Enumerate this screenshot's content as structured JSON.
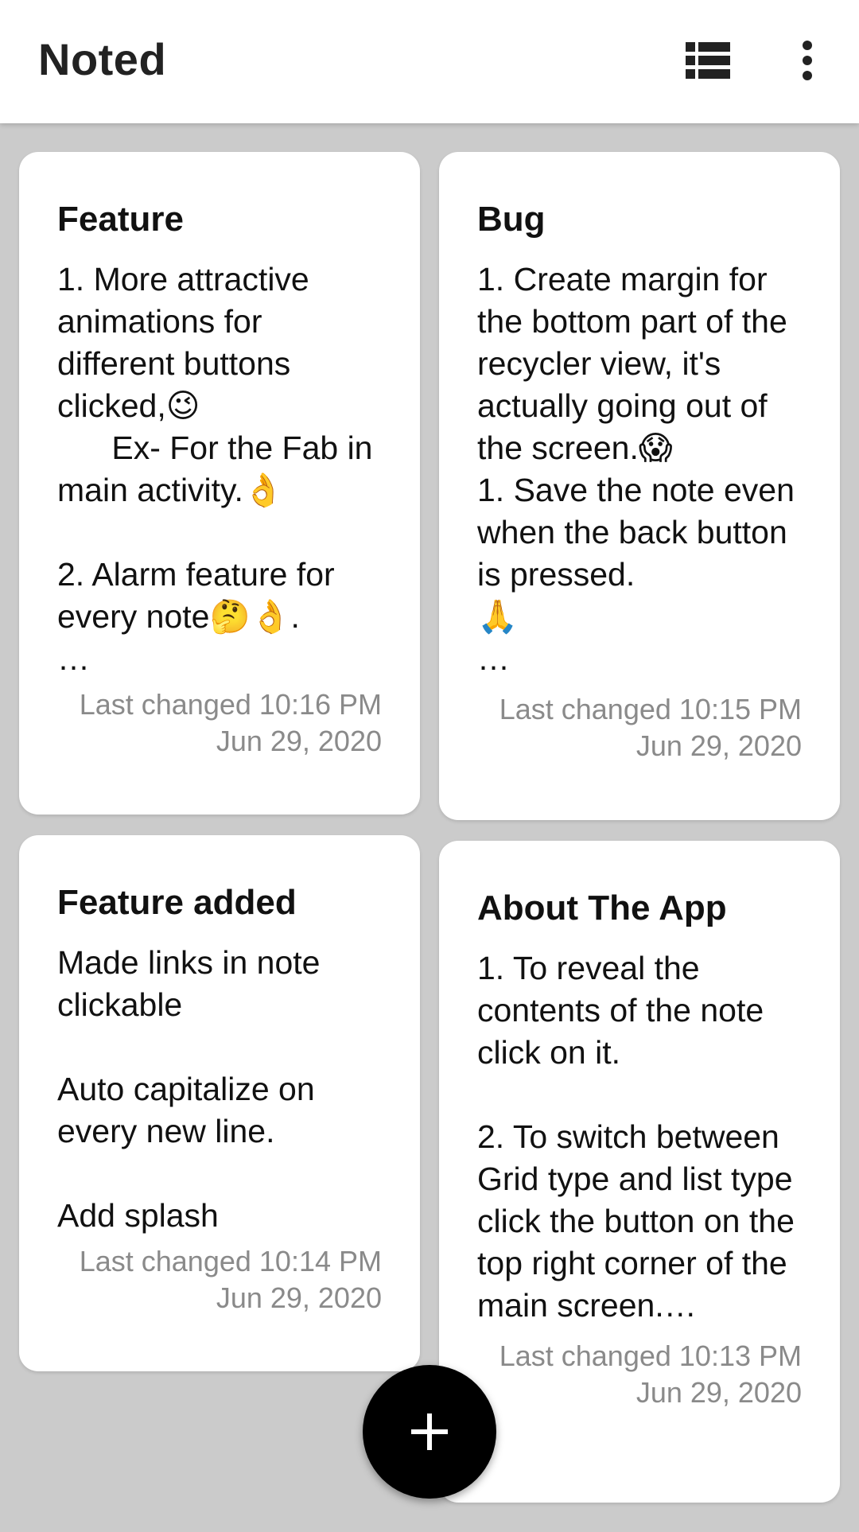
{
  "app": {
    "title": "Noted"
  },
  "toolbar": {
    "view_toggle_icon": "view-list-icon",
    "more_icon": "more-vert-icon"
  },
  "notes": [
    {
      "title": "Feature",
      "body": "1. More attractive animations for different buttons clicked,😉\n      Ex- For the Fab in main activity.👌\n\n2. Alarm feature for every note🤔👌.\n…",
      "last_changed": "Last changed 10:16 PM Jun 29, 2020"
    },
    {
      "title": "Bug",
      "body": "1. Create margin for the bottom part of the recycler view, it's actually going out of the screen.😱\n1. Save the note even when the back button is pressed.\n🙏\n…",
      "last_changed": "Last changed 10:15 PM Jun 29, 2020"
    },
    {
      "title": "Feature added",
      "body": "Made links in note clickable\n\nAuto capitalize on every new line.\n\nAdd splash",
      "last_changed": "Last changed 10:14 PM Jun 29, 2020"
    },
    {
      "title": "About The App",
      "body": "1. To reveal the contents of the note click on it.\n\n2. To switch between Grid type and list type click the button on the top right corner of the main screen.…",
      "last_changed": "Last changed 10:13 PM Jun 29, 2020"
    }
  ],
  "fab": {
    "icon": "add-icon"
  },
  "colors": {
    "background": "#cbcbcb",
    "card": "#ffffff",
    "fab": "#000000",
    "date_text": "#8a8a8a"
  }
}
